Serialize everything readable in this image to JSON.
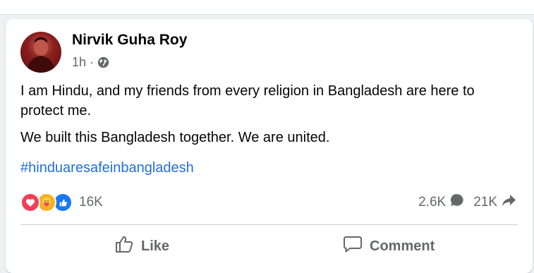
{
  "post": {
    "author": "Nirvik Guha Roy",
    "time": "1h",
    "separator": "·",
    "privacy_icon": "globe-icon",
    "paragraphs": [
      "I am Hindu, and my friends from every religion in Bangladesh are here to protect me.",
      "We built this Bangladesh together. We are united."
    ],
    "hashtag": "#hinduaresafeinbangladesh"
  },
  "engagement": {
    "reaction_icons": [
      "love-icon",
      "care-icon",
      "like-icon"
    ],
    "reaction_count": "16K",
    "comment_count": "2.6K",
    "share_count": "21K"
  },
  "actions": {
    "like_label": "Like",
    "comment_label": "Comment"
  },
  "colors": {
    "link": "#216fdb",
    "secondary_text": "#65676b",
    "love": "#f33e58",
    "care": "#f7b125",
    "like": "#1877f2"
  }
}
